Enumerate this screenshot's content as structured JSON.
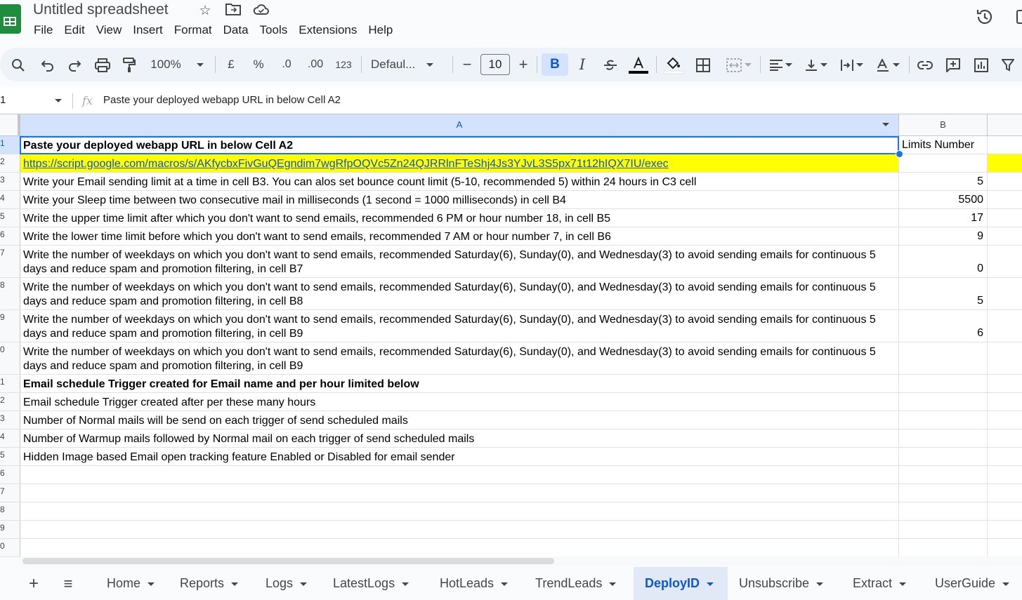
{
  "app": {
    "title": "Untitled spreadsheet"
  },
  "menu": [
    "File",
    "Edit",
    "View",
    "Insert",
    "Format",
    "Data",
    "Tools",
    "Extensions",
    "Help"
  ],
  "toolbar": {
    "zoom": "100%",
    "currency": "£",
    "percent": "%",
    "dec_decrease": ".0",
    "dec_increase": ".00",
    "number_format": "123",
    "font": "Defaul...",
    "font_size": "10",
    "bold": "B",
    "italic": "I"
  },
  "formula_bar": {
    "name_box": "1",
    "fx": "fx",
    "content": "Paste your deployed webapp URL in below Cell A2"
  },
  "columns": [
    "A",
    "B"
  ],
  "rows": [
    {
      "n": "1",
      "a": "Paste your deployed webapp URL in below Cell A2",
      "b": "Limits Number"
    },
    {
      "n": "2",
      "a": "https://script.google.com/macros/s/AKfycbxFivGuQEgndim7wgRfpOQVc5Zn24QJRRlnFTeShj4Js3YJvL3S5px71t12hIQX7IU/exec",
      "b": ""
    },
    {
      "n": "3",
      "a": "Write your Email sending limit at a time in cell B3. You can alos set bounce count limit (5-10, recommended 5) within 24 hours in C3 cell",
      "b": "5"
    },
    {
      "n": "4",
      "a": "Write your Sleep time between two consecutive mail in milliseconds (1 second = 1000 milliseconds) in cell B4",
      "b": "5500"
    },
    {
      "n": "5",
      "a": "Write the upper time limit after which you don't want to send emails, recommended 6 PM or hour number 18, in cell B5",
      "b": "17"
    },
    {
      "n": "6",
      "a": "Write the lower time limit before which you don't want to send emails, recommended 7 AM or hour number 7, in cell B6",
      "b": "9"
    },
    {
      "n": "7",
      "a": "Write the number of weekdays on which you don't want to send emails, recommended Saturday(6), Sunday(0), and Wednesday(3) to avoid sending emails for continuous 5 days and reduce spam and promotion filtering, in cell B7",
      "b": "0"
    },
    {
      "n": "8",
      "a": "Write the number of weekdays on which you don't want to send emails, recommended Saturday(6), Sunday(0), and Wednesday(3) to avoid sending emails for continuous 5 days and reduce spam and promotion filtering, in cell B8",
      "b": "5"
    },
    {
      "n": "9",
      "a": "Write the number of weekdays on which you don't want to send emails, recommended Saturday(6), Sunday(0), and Wednesday(3) to avoid sending emails for continuous 5 days and reduce spam and promotion filtering, in cell B9",
      "b": "6"
    },
    {
      "n": "0",
      "a": "Write the number of weekdays on which you don't want to send emails, recommended Saturday(6), Sunday(0), and Wednesday(3) to avoid sending emails for continuous 5 days and reduce spam and promotion filtering, in cell B9",
      "b": ""
    },
    {
      "n": "1",
      "a": "Email schedule Trigger created for Email name and per hour limited below",
      "b": ""
    },
    {
      "n": "2",
      "a": "Email schedule Trigger created after per these many hours",
      "b": ""
    },
    {
      "n": "3",
      "a": "Number of Normal mails will be send on each trigger of send scheduled mails",
      "b": ""
    },
    {
      "n": "4",
      "a": "Number of Warmup mails followed by Normal mail on each trigger of send scheduled mails",
      "b": ""
    },
    {
      "n": "5",
      "a": "Hidden Image based Email open tracking feature Enabled or Disabled for email sender",
      "b": ""
    },
    {
      "n": "6",
      "a": "",
      "b": ""
    },
    {
      "n": "7",
      "a": "",
      "b": ""
    },
    {
      "n": "8",
      "a": "",
      "b": ""
    },
    {
      "n": "9",
      "a": "",
      "b": ""
    },
    {
      "n": "0",
      "a": "",
      "b": ""
    }
  ],
  "sheets": {
    "add": "+",
    "all": "≡",
    "tabs": [
      "Home",
      "Reports",
      "Logs",
      "LatestLogs",
      "HotLeads",
      "TrendLeads",
      "DeployID",
      "Unsubscribe",
      "Extract",
      "UserGuide"
    ],
    "active": "DeployID"
  }
}
